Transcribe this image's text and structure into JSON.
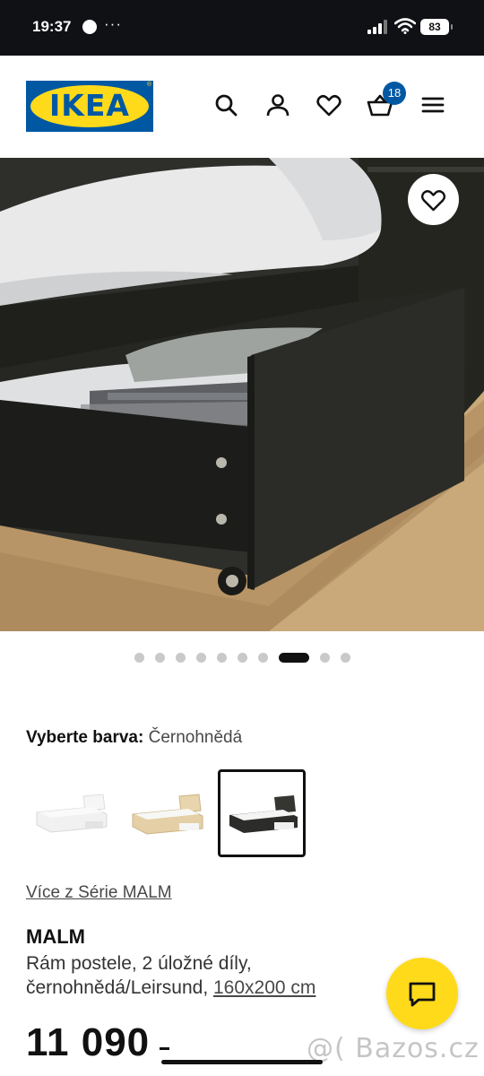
{
  "status_bar": {
    "time": "19:37",
    "more": "···",
    "battery": "83"
  },
  "header": {
    "logo_text": "IKEA",
    "logo_reg": "®",
    "cart_count": "18",
    "icons": [
      "search-icon",
      "user-icon",
      "heart-icon",
      "cart-icon",
      "menu-icon"
    ]
  },
  "gallery": {
    "image_count": 11,
    "active_index": 7
  },
  "color_selector": {
    "label": "Vyberte barva:",
    "value": "Černohnědá",
    "variants": [
      "white",
      "oak-veneer",
      "black-brown"
    ],
    "selected_index": 2
  },
  "product": {
    "series_link": "Více z Série MALM",
    "name": "MALM",
    "desc_line1": "Rám postele, 2 úložné díly,",
    "desc_line2": "černohnědá/Leirsund,",
    "size": "160x200 cm",
    "price": "11 090"
  },
  "watermark": "@( Bazos.cz",
  "colors": {
    "ikea_blue": "#0058a3",
    "ikea_yellow": "#ffda1a",
    "status_bg": "#0f1115"
  }
}
